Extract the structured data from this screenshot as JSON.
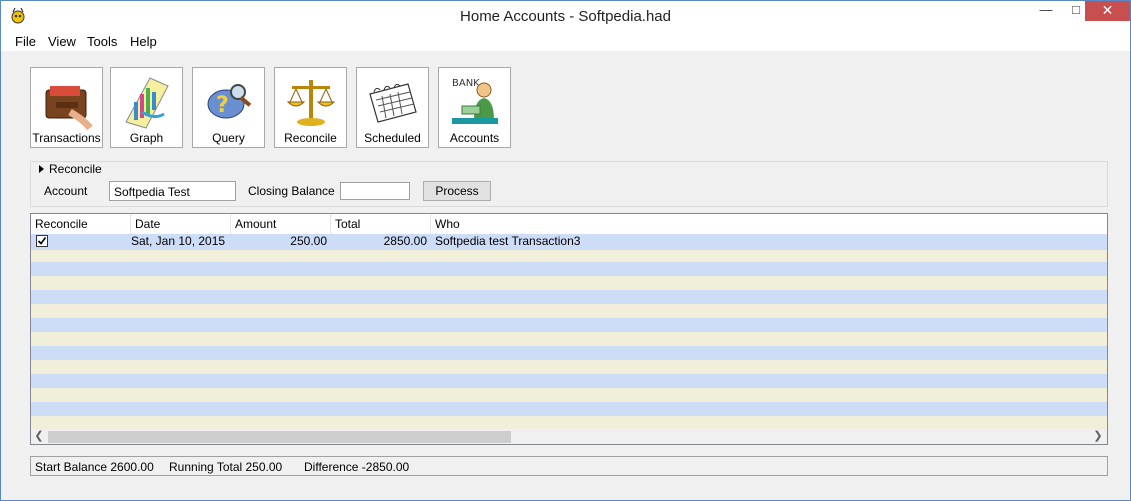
{
  "window": {
    "title": "Home Accounts - Softpedia.had"
  },
  "menu": [
    "File",
    "View",
    "Tools",
    "Help"
  ],
  "toolbar": [
    {
      "label": "Transactions",
      "icon": "wallet-icon"
    },
    {
      "label": "Graph",
      "icon": "graph-icon"
    },
    {
      "label": "Query",
      "icon": "magnifier-icon"
    },
    {
      "label": "Reconcile",
      "icon": "scales-icon"
    },
    {
      "label": "Scheduled",
      "icon": "calendar-icon"
    },
    {
      "label": "Accounts",
      "icon": "bank-teller-icon"
    }
  ],
  "reconcile": {
    "group_title": "Reconcile",
    "account_label": "Account",
    "account_value": "Softpedia Test",
    "closing_balance_label": "Closing Balance",
    "closing_balance_value": "",
    "process_label": "Process"
  },
  "grid": {
    "columns": [
      "Reconcile",
      "Date",
      "Amount",
      "Total",
      "Who"
    ],
    "rows": [
      {
        "reconciled": true,
        "date": "Sat, Jan 10, 2015",
        "amount": "250.00",
        "total": "2850.00",
        "who": "Softpedia test Transaction3"
      }
    ]
  },
  "status": {
    "start_balance": "Start Balance 2600.00",
    "running_total": "Running Total 250.00",
    "difference": "Difference -2850.00"
  }
}
